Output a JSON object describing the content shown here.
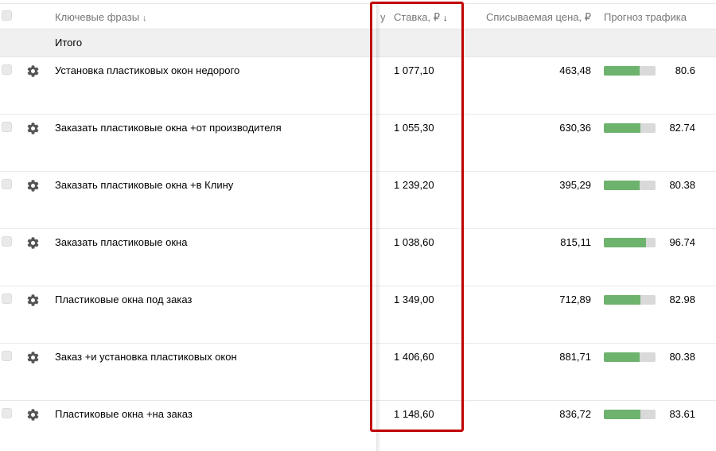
{
  "header": {
    "keywords_label": "Ключевые фразы",
    "keywords_sort": "↓",
    "clipped_label": "у",
    "bid_label": "Ставка, ₽",
    "bid_sort": "↓",
    "price_label": "Списываемая цена, ₽",
    "forecast_label": "Прогноз трафика"
  },
  "total": {
    "label": "Итого"
  },
  "icons": {
    "row_settings": "gear-icon"
  },
  "colors": {
    "highlight": "#c00000",
    "bar_fill": "#6db36d",
    "bar_track": "#d9d9d9"
  },
  "rows": [
    {
      "keyword": "Установка пластиковых окон недорого",
      "bid": "1 077,10",
      "price": "463,48",
      "forecast": "80.6",
      "bar_fraction": 0.69
    },
    {
      "keyword": "Заказать пластиковые окна +от производителя",
      "bid": "1 055,30",
      "price": "630,36",
      "forecast": "82.74",
      "bar_fraction": 0.71
    },
    {
      "keyword": "Заказать пластиковые окна +в Клину",
      "bid": "1 239,20",
      "price": "395,29",
      "forecast": "80.38",
      "bar_fraction": 0.69
    },
    {
      "keyword": "Заказать пластиковые окна",
      "bid": "1 038,60",
      "price": "815,11",
      "forecast": "96.74",
      "bar_fraction": 0.82
    },
    {
      "keyword": "Пластиковые окна под заказ",
      "bid": "1 349,00",
      "price": "712,89",
      "forecast": "82.98",
      "bar_fraction": 0.71
    },
    {
      "keyword": "Заказ +и установка пластиковых окон",
      "bid": "1 406,60",
      "price": "881,71",
      "forecast": "80.38",
      "bar_fraction": 0.69
    },
    {
      "keyword": "Пластиковые окна +на заказ",
      "bid": "1 148,60",
      "price": "836,72",
      "forecast": "83.61",
      "bar_fraction": 0.71
    }
  ]
}
